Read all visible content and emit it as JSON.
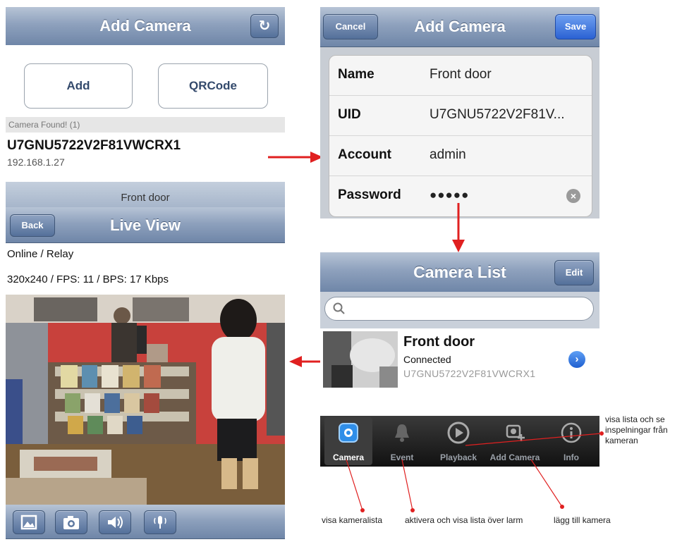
{
  "add_camera_screen": {
    "title": "Add Camera",
    "add_button": "Add",
    "qrcode_button": "QRCode",
    "found_label": "Camera Found! (1)",
    "found_uid": "U7GNU5722V2F81VWCRX1",
    "found_ip": "192.168.1.27",
    "icon": "refresh-icon"
  },
  "edit_screen": {
    "title": "Add Camera",
    "cancel_button": "Cancel",
    "save_button": "Save",
    "fields": [
      {
        "label": "Name",
        "value": "Front door"
      },
      {
        "label": "UID",
        "value": "U7GNU5722V2F81V..."
      },
      {
        "label": "Account",
        "value": "admin"
      },
      {
        "label": "Password",
        "value": "●●●●●"
      }
    ]
  },
  "live_view_screen": {
    "header_strip_text": "Front door",
    "title": "Live View",
    "back_button": "Back",
    "status_text": "Online / Relay",
    "stats_text": "320x240 / FPS: 11 / BPS: 17 Kbps",
    "toolbar_icons": [
      "photo-icon",
      "camera-icon",
      "speaker-icon",
      "microphone-icon"
    ]
  },
  "camera_list_screen": {
    "title": "Camera List",
    "edit_button": "Edit",
    "camera": {
      "name": "Front door",
      "status": "Connected",
      "uid": "U7GNU5722V2F81VWCRX1"
    },
    "tabs": [
      {
        "label": "Camera",
        "icon": "camera-tab-icon"
      },
      {
        "label": "Event",
        "icon": "bell-icon"
      },
      {
        "label": "Playback",
        "icon": "play-icon"
      },
      {
        "label": "Add Camera",
        "icon": "add-camera-icon"
      },
      {
        "label": "Info",
        "icon": "info-icon"
      }
    ]
  },
  "annotations": {
    "playback_line1": "visa lista och se",
    "playback_line2": "inspelningar från",
    "playback_line3": "kameran",
    "camera": "visa kameralista",
    "event": "aktivera och visa lista över larm",
    "add_camera": "lägg till kamera"
  },
  "colors": {
    "accent_red": "#e02020",
    "nav_bar": "#8ea1bd",
    "save_blue": "#2b62d3"
  }
}
